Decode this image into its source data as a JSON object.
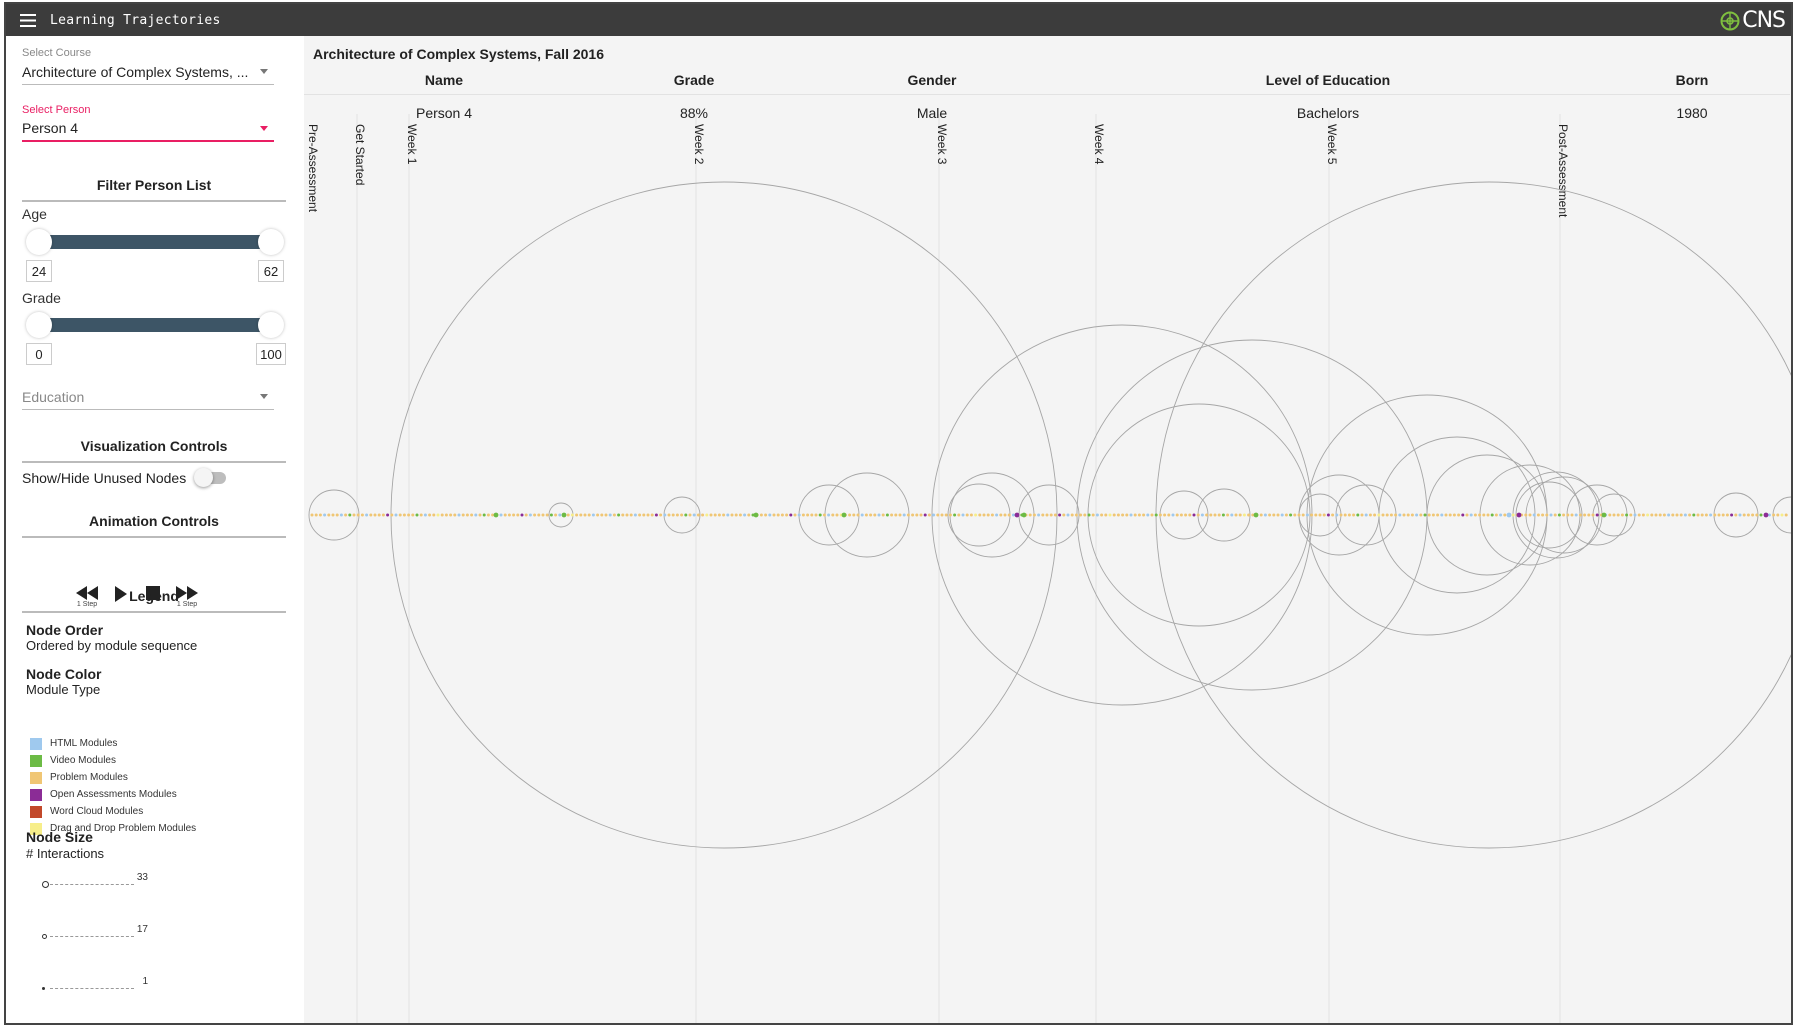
{
  "app": {
    "title": "Learning Trajectories",
    "logo_text": "CNS",
    "colors": {
      "topbar": "#3c3c3c",
      "accent": "#e91e63",
      "slider": "#3d5566",
      "panel": "#f4f4f4"
    }
  },
  "sidebar": {
    "course_label": "Select Course",
    "course_value": "Architecture of Complex Systems, ...",
    "person_label": "Select Person",
    "person_value": "Person 4",
    "filter_heading": "Filter Person List",
    "age_label": "Age",
    "age_min": "24",
    "age_max": "62",
    "grade_label": "Grade",
    "grade_min": "0",
    "grade_max": "100",
    "education_placeholder": "Education",
    "viz_heading": "Visualization Controls",
    "toggle_label": "Show/Hide Unused Nodes",
    "anim_heading": "Animation Controls",
    "step_back_sub": "1 Step",
    "step_forward_sub": "1 Step",
    "legend_heading": "Legend",
    "node_order_heading": "Node Order",
    "node_order_text": "Ordered by module sequence",
    "node_color_heading": "Node Color",
    "node_color_text": "Module Type",
    "legend_items": [
      {
        "label": "HTML Modules",
        "color": "#9fc9ee"
      },
      {
        "label": "Video Modules",
        "color": "#6cbb45"
      },
      {
        "label": "Problem Modules",
        "color": "#f0c674"
      },
      {
        "label": "Open Assessments Modules",
        "color": "#8b2c96"
      },
      {
        "label": "Word Cloud Modules",
        "color": "#c2482a"
      },
      {
        "label": "Drag and Drop Problem Modules",
        "color": "#f7ee8a"
      }
    ],
    "node_size_heading": "Node Size",
    "node_size_text": "# Interactions",
    "size_labels": [
      "33",
      "17",
      "1"
    ]
  },
  "main": {
    "course_title": "Architecture of Complex Systems, Fall 2016",
    "columns": [
      "Name",
      "Grade",
      "Gender",
      "Level of Education",
      "Born"
    ],
    "person": [
      "Person 4",
      "88%",
      "Male",
      "Bachelors",
      "1980"
    ],
    "sections": [
      "Pre-Assessment",
      "Get Started",
      "Week 1",
      "Week 2",
      "Week 3",
      "Week 4",
      "Week 5",
      "Post-Assessment"
    ]
  },
  "chart_data": {
    "type": "arc",
    "node_order": "Ordered by module sequence",
    "node_color": "Module Type",
    "node_size": "# Interactions",
    "node_size_legend": [
      33,
      17,
      1
    ],
    "sections": [
      "Pre-Assessment",
      "Get Started",
      "Week 1",
      "Week 2",
      "Week 3",
      "Week 4",
      "Week 5",
      "Post-Assessment"
    ]
  }
}
